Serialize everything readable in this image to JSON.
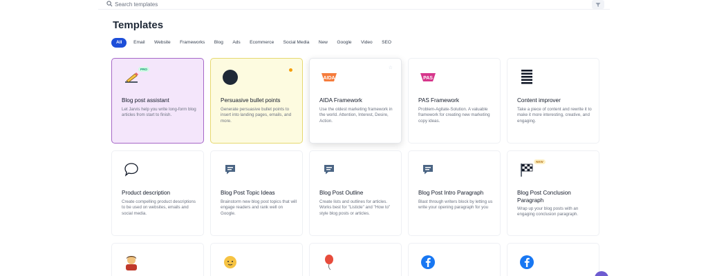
{
  "search": {
    "placeholder": "Search templates"
  },
  "page_title": "Templates",
  "tabs": [
    "All",
    "Email",
    "Website",
    "Frameworks",
    "Blog",
    "Ads",
    "Ecommerce",
    "Social Media",
    "New",
    "Google",
    "Video",
    "SEO"
  ],
  "active_tab": "All",
  "badges": {
    "pro": "PRO",
    "new": "NEW"
  },
  "aida_icon_text": "AIDA",
  "pas_icon_text": "PAS",
  "cards": [
    {
      "title": "Blog post assistant",
      "desc": "Let Jarvis help you write long-form blog articles from start to finish."
    },
    {
      "title": "Persuasive bullet points",
      "desc": "Generate persuasive bullet points to insert into landing pages, emails, and more."
    },
    {
      "title": "AIDA Framework",
      "desc": "Use the oldest marketing framework in the world. Attention, Interest, Desire, Action."
    },
    {
      "title": "PAS Framework",
      "desc": "Problem-Agitate-Solution. A valuable framework for creating new marketing copy ideas."
    },
    {
      "title": "Content improver",
      "desc": "Take a piece of content and rewrite it to make it more interesting, creative, and engaging."
    },
    {
      "title": "Product description",
      "desc": "Create compelling product descriptions to be used on websites, emails and social media."
    },
    {
      "title": "Blog Post Topic Ideas",
      "desc": "Brainstorm new blog post topics that will engage readers and rank well on Google."
    },
    {
      "title": "Blog Post Outline",
      "desc": "Create lists and outlines for articles. Works best for \"Listicle\" and \"How to\" style blog posts or articles."
    },
    {
      "title": "Blog Post Intro Paragraph",
      "desc": "Blast through writers block by letting us write your opening paragraph for you"
    },
    {
      "title": "Blog Post Conclusion Paragraph",
      "desc": "Wrap up your blog posts with an engaging conclusion paragraph."
    }
  ],
  "colors": {
    "accent": "#1d4ed8",
    "pro_badge": "#059669",
    "facebook": "#1877f2",
    "purple_card": "#f4e6fb",
    "yellow_card": "#fdfbe0"
  }
}
